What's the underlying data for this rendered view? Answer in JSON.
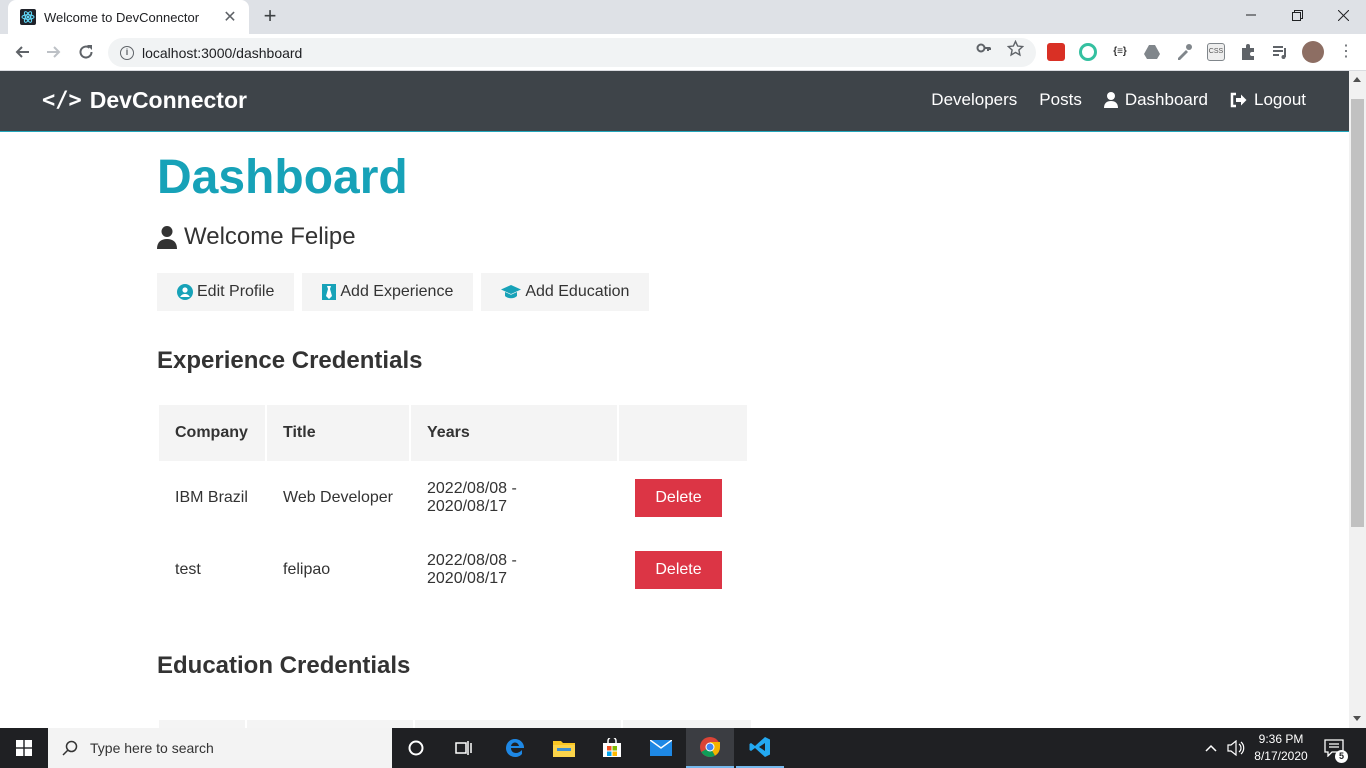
{
  "browser": {
    "tab_title": "Welcome to DevConnector",
    "url": "localhost:3000/dashboard"
  },
  "navbar": {
    "brand": "DevConnector",
    "brand_icon": "</>",
    "links": {
      "developers": "Developers",
      "posts": "Posts",
      "dashboard": "Dashboard",
      "logout": "Logout"
    }
  },
  "dashboard": {
    "title": "Dashboard",
    "welcome": "Welcome Felipe",
    "buttons": {
      "edit_profile": "Edit Profile",
      "add_experience": "Add Experience",
      "add_education": "Add Education"
    }
  },
  "experience": {
    "title": "Experience Credentials",
    "headers": [
      "Company",
      "Title",
      "Years",
      ""
    ],
    "rows": [
      {
        "company": "IBM Brazil",
        "title": "Web Developer",
        "years": "2022/08/08 - 2020/08/17",
        "action": "Delete"
      },
      {
        "company": "test",
        "title": "felipao",
        "years": "2022/08/08 - 2020/08/17",
        "action": "Delete"
      }
    ]
  },
  "education": {
    "title": "Education Credentials"
  },
  "taskbar": {
    "search_placeholder": "Type here to search",
    "time": "9:36 PM",
    "date": "8/17/2020",
    "notifications": "5"
  },
  "colors": {
    "primary": "#17a2b8",
    "dark": "#343a40",
    "light": "#f4f4f4",
    "danger": "#dc3545"
  }
}
